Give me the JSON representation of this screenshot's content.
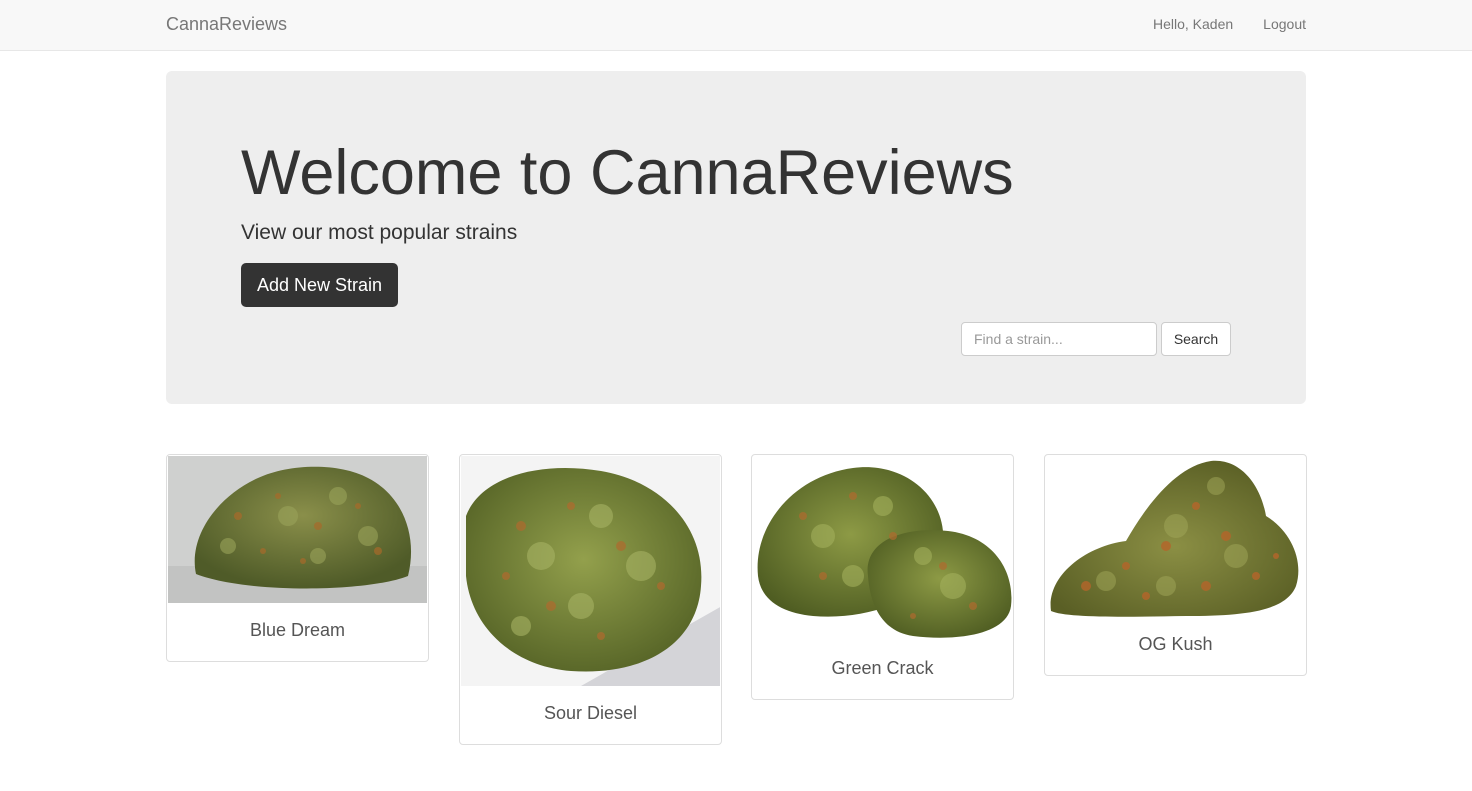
{
  "navbar": {
    "brand": "CannaReviews",
    "greeting": "Hello, Kaden",
    "logout": "Logout"
  },
  "jumbotron": {
    "title": "Welcome to CannaReviews",
    "subtitle": "View our most popular strains",
    "add_button": "Add New Strain",
    "search_placeholder": "Find a strain...",
    "search_button": "Search"
  },
  "strains": [
    {
      "name": "Blue Dream",
      "image": "cannabis-bud-photo"
    },
    {
      "name": "Sour Diesel",
      "image": "cannabis-bud-photo"
    },
    {
      "name": "Green Crack",
      "image": "cannabis-bud-photo"
    },
    {
      "name": "OG Kush",
      "image": "cannabis-bud-photo"
    }
  ],
  "colors": {
    "navbar_bg": "#f8f8f8",
    "jumbotron_bg": "#eeeeee",
    "primary_button": "#333333",
    "bud_green": "#6f7f3a",
    "bud_orange": "#b5652a"
  }
}
